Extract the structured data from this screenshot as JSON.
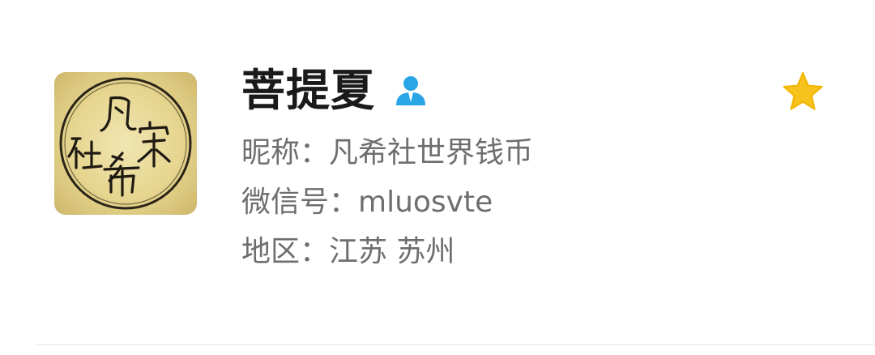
{
  "profile": {
    "display_name": "菩提夏",
    "nickname_label": "昵称：",
    "nickname_value": "凡希社世界钱币",
    "wechat_id_label": "微信号：",
    "wechat_id_value": "mluosvte",
    "region_label": "地区：",
    "region_value": "江苏 苏州",
    "avatar_icon": "seal-stamp-avatar",
    "avatar_text": "凡希社宋",
    "badge_icon": "person-icon",
    "favorite_icon": "star-icon"
  },
  "colors": {
    "name_text": "#1a1a1a",
    "info_text": "#6e6e6e",
    "star": "#f7c21b",
    "badge": "#2aa6e6",
    "divider": "#e5e5e5"
  }
}
